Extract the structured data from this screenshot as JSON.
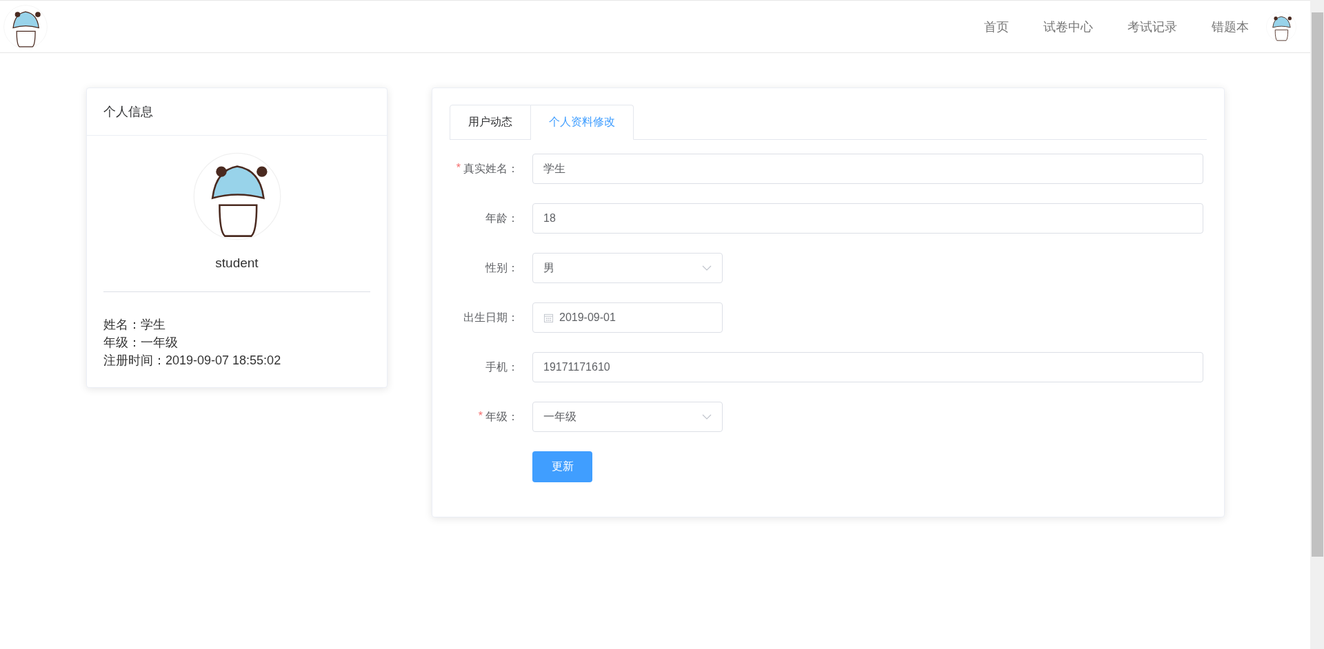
{
  "header": {
    "nav": [
      {
        "label": "首页"
      },
      {
        "label": "试卷中心"
      },
      {
        "label": "考试记录"
      },
      {
        "label": "错题本"
      }
    ]
  },
  "profile_card": {
    "title": "个人信息",
    "username": "student",
    "details": [
      "姓名：学生",
      "年级：一年级",
      "注册时间：2019-09-07 18:55:02"
    ]
  },
  "tabs": [
    {
      "label": "用户动态",
      "selected": false
    },
    {
      "label": "个人资料修改",
      "selected": true
    }
  ],
  "form": {
    "fields": [
      {
        "label": "真实姓名：",
        "required": true,
        "kind": "input",
        "value": "学生"
      },
      {
        "label": "年龄：",
        "required": false,
        "kind": "input",
        "value": "18"
      },
      {
        "label": "性别：",
        "required": false,
        "kind": "select",
        "value": "男"
      },
      {
        "label": "出生日期：",
        "required": false,
        "kind": "date",
        "value": "2019-09-01"
      },
      {
        "label": "手机：",
        "required": false,
        "kind": "input",
        "value": "19171171610"
      },
      {
        "label": "年级：",
        "required": true,
        "kind": "select",
        "value": "一年级"
      }
    ],
    "required_mark": "*",
    "submit": "更新"
  }
}
